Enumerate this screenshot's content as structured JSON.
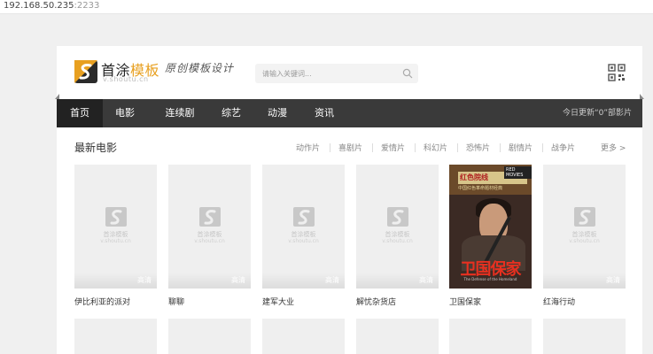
{
  "browser": {
    "url_host": "192.168.50.235",
    "url_port": ":2233"
  },
  "header": {
    "logo_text_main": "首涂",
    "logo_text_accent": "模板",
    "logo_sub": "v.shoutu.cn",
    "slogan": "原创模板设计",
    "search_placeholder": "请输入关键词..."
  },
  "nav": {
    "items": [
      {
        "label": "首页"
      },
      {
        "label": "电影"
      },
      {
        "label": "连续剧"
      },
      {
        "label": "综艺"
      },
      {
        "label": "动漫"
      },
      {
        "label": "资讯"
      }
    ],
    "update_text": "今日更新“0”部影片"
  },
  "section": {
    "title": "最新电影",
    "categories": [
      "动作片",
      "喜剧片",
      "爱情片",
      "科幻片",
      "恐怖片",
      "剧情片",
      "战争片"
    ],
    "more": "更多 >"
  },
  "placeholder": {
    "name": "首涂模板",
    "url": "v.shoutu.cn"
  },
  "poster": {
    "band": "红色院线",
    "red_tag": "RED MOVIES",
    "sub": "中国红色革命题材经典",
    "title": "卫国保家",
    "foot": "The Defense of the Homeland"
  },
  "movies": [
    {
      "title": "伊比利亚的派对",
      "badge": "高清"
    },
    {
      "title": "聊聊",
      "badge": "高清"
    },
    {
      "title": "建军大业",
      "badge": "高清"
    },
    {
      "title": "解忧杂货店",
      "badge": "高清"
    },
    {
      "title": "卫国保家",
      "badge": ""
    },
    {
      "title": "红海行动",
      "badge": "高清"
    }
  ],
  "colors": {
    "nav_bg": "#3a3a3a",
    "nav_active": "#222222",
    "accent": "#e8a020",
    "page_bg": "#f0f0f0"
  }
}
